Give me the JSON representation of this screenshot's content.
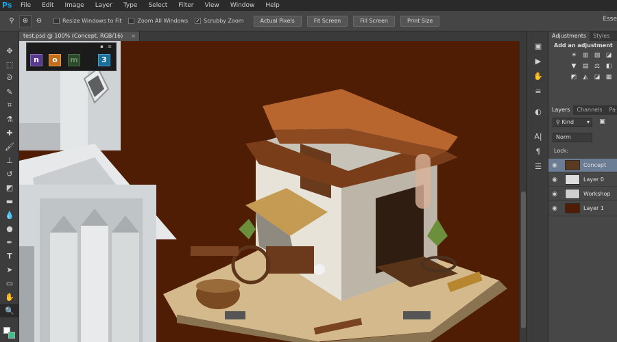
{
  "app_logo": "Ps",
  "menu": [
    "File",
    "Edit",
    "Image",
    "Layer",
    "Type",
    "Select",
    "Filter",
    "View",
    "Window",
    "Help"
  ],
  "options": {
    "tool_icons": [
      "zoom-tool-icon",
      "zoom-in-icon",
      "zoom-out-icon"
    ],
    "checkboxes": [
      {
        "label": "Resize Windows to Fit",
        "checked": false
      },
      {
        "label": "Zoom All Windows",
        "checked": false
      },
      {
        "label": "Scrubby Zoom",
        "checked": true
      }
    ],
    "buttons": [
      "Actual Pixels",
      "Fit Screen",
      "Fill Screen",
      "Print Size"
    ],
    "workspace": "Esse"
  },
  "document": {
    "tab_title": "test.psd @ 100% (Concept, RGB/16)",
    "tab_close": "×"
  },
  "palette": {
    "grip": "▪ ≡",
    "letters": [
      "n",
      "o",
      "m",
      "",
      "3"
    ]
  },
  "adjustments": {
    "tabs": [
      "Adjustments",
      "Styles"
    ],
    "title": "Add an adjustment"
  },
  "layers": {
    "tabs": [
      "Layers",
      "Channels",
      "Pa"
    ],
    "kind": "Kind",
    "blend": "Norm",
    "lock_label": "Lock:",
    "items": [
      {
        "name": "Concept",
        "selected": true
      },
      {
        "name": "Layer 0",
        "selected": false
      },
      {
        "name": "Workshop",
        "selected": false
      },
      {
        "name": "Layer 1",
        "selected": false
      }
    ]
  },
  "colors": {
    "canvas_bg": "#4f1c04",
    "selected_layer": "#6a7d95",
    "accent": "#1ca8e8"
  }
}
